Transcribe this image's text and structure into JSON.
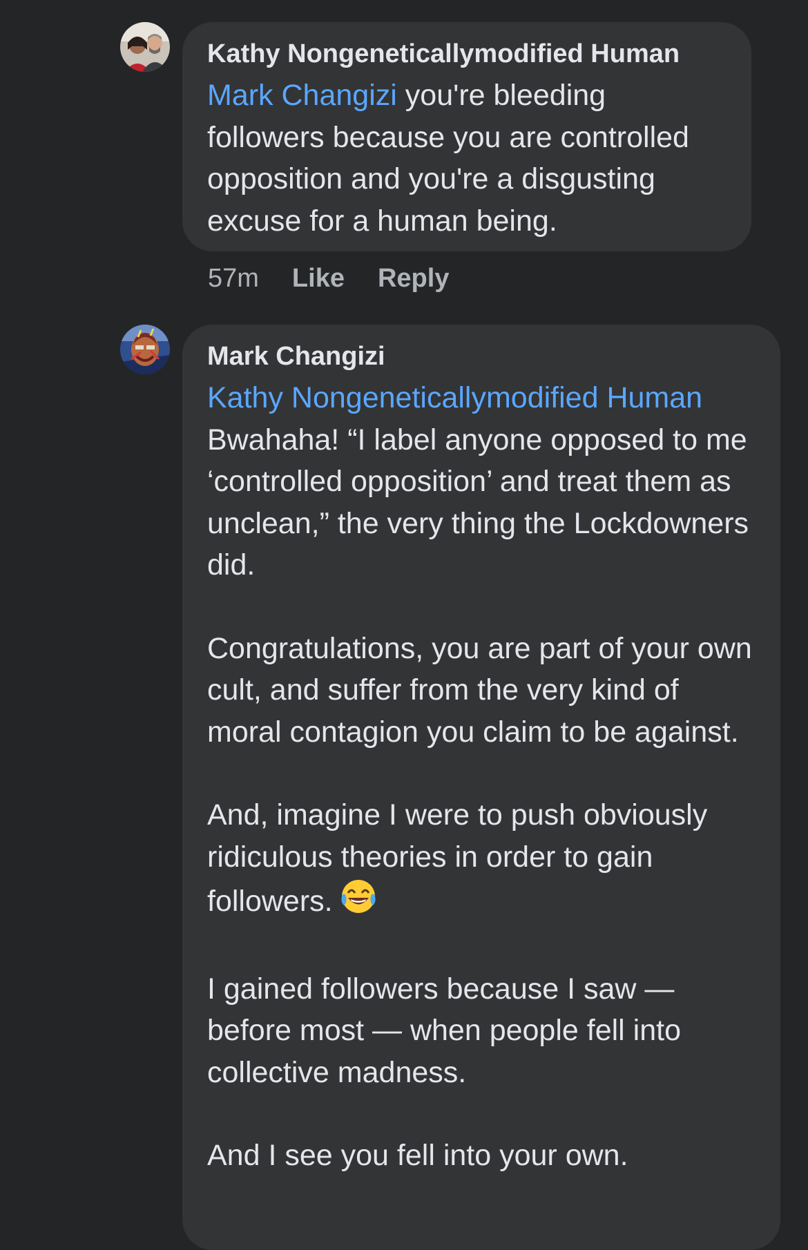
{
  "comments": [
    {
      "author": "Kathy Nongeneticallymodified Human",
      "mention": "Mark Changizi",
      "paragraphs": [
        " you're bleeding followers because you are controlled opposition and you're a disgusting excuse for a human being."
      ],
      "time": "57m",
      "like_label": "Like",
      "reply_label": "Reply"
    },
    {
      "author": "Mark Changizi",
      "mention": "Kathy Nongeneticallymodified Human",
      "paragraphs": [
        "Bwahaha! “I label anyone opposed to me ‘controlled opposition’ and treat them as unclean,” the very thing the Lockdowners did.",
        "Congratulations, you are part of your own cult, and suffer from the very kind of moral contagion you claim to be against.",
        "And, imagine I were to push obviously ridiculous theories in order to gain followers.",
        "I gained followers because I saw — before most — when people fell into collective madness.",
        "And I see you fell into your own."
      ],
      "emoji": "face-with-tears-of-joy"
    }
  ],
  "colors": {
    "background": "#242526",
    "bubble": "#333436",
    "text": "#e4e6eb",
    "mention": "#5aa7ff",
    "meta": "#b0b3b8"
  }
}
